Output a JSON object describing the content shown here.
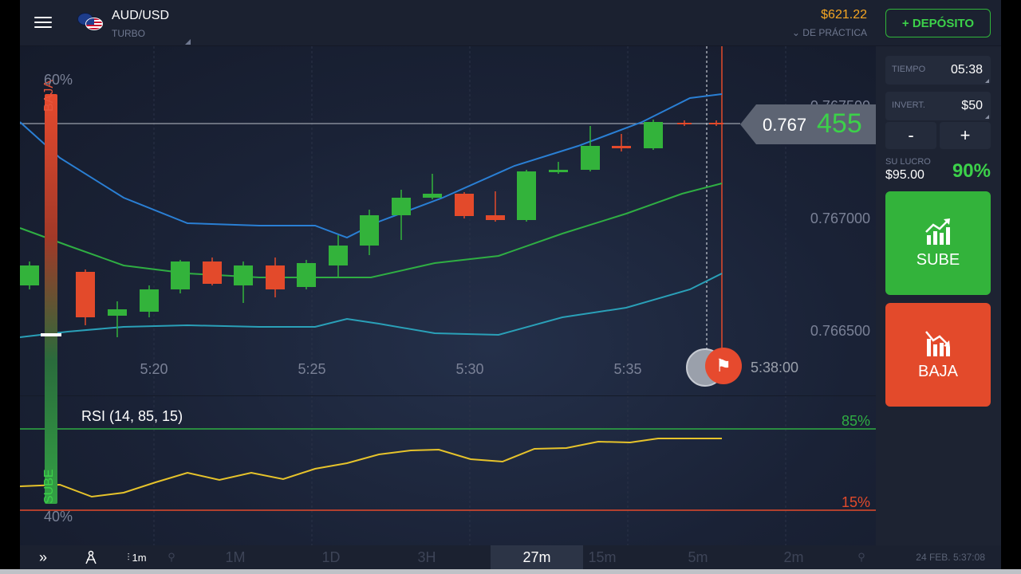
{
  "header": {
    "asset_name": "AUD/USD",
    "asset_type": "TURBO",
    "balance": "$621.22",
    "account_mode": "⌄ DE PRÁCTICA",
    "deposit_label": "+ DEPÓSITO"
  },
  "chart": {
    "price_axis": [
      "0.767500",
      "0.767000",
      "0.766500"
    ],
    "time_axis": [
      "5:20",
      "5:25",
      "5:30",
      "5:35"
    ],
    "current_price_main": "0.767",
    "current_price_hi": "455",
    "expiry_time": "5:38:00",
    "sentiment_top_pct": "60%",
    "sentiment_bottom_pct": "40%",
    "sentiment_baja_label": "BAJA",
    "sentiment_sube_label": "SUBE",
    "up_color": "#33b33b",
    "down_color": "#e34a2b"
  },
  "rsi": {
    "label": "RSI  (14,  85,  15)",
    "upper_label": "85%",
    "lower_label": "15%"
  },
  "panel": {
    "time_label": "TIEMPO",
    "time_value": "05:38",
    "invest_label": "INVERT.",
    "invest_value": "$50",
    "minus_label": "-",
    "plus_label": "+",
    "profit_label": "SU LUCRO",
    "profit_value": "$95.00",
    "profit_pct": "90%",
    "up_label": "SUBE",
    "down_label": "BAJA"
  },
  "toolbar": {
    "expand_icon": "»",
    "tools_icon": "compass-icon",
    "candle_interval": "1m",
    "ranges": [
      "1M",
      "1D",
      "3H",
      "27m",
      "15m",
      "5m",
      "2m"
    ],
    "active_range": "27m",
    "datetime": "24 FEB. 5:37:08"
  }
}
